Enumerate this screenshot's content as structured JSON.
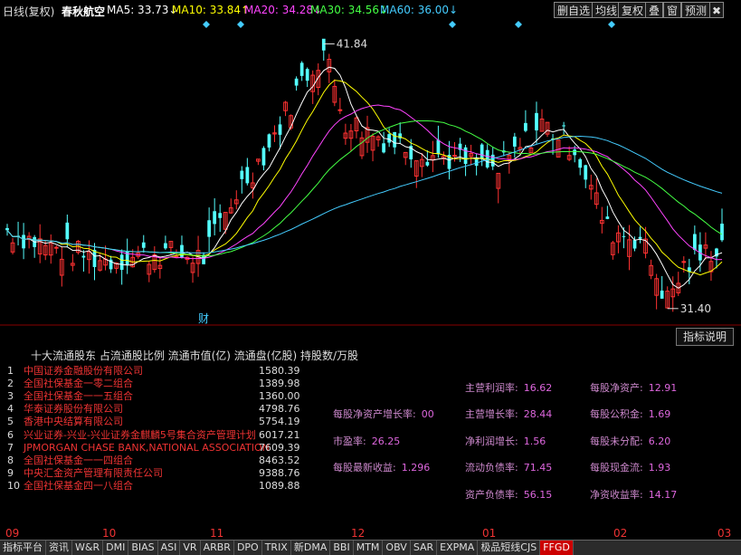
{
  "title_bar": {
    "chart_mode": "日线(复权)",
    "stock_name": "春秋航空",
    "ma5": "MA5: 33.73↓",
    "ma10": "MA10: 33.84↑",
    "ma20": "MA20: 34.28↓",
    "ma30": "MA30: 34.56↓",
    "ma60": "MA60: 36.00↓",
    "colors": {
      "ma5": "#ffffff",
      "ma10": "#ffff00",
      "ma20": "#ff44ff",
      "ma30": "#44ff44",
      "ma60": "#44ccff"
    }
  },
  "toolbar": {
    "delete_watchlist": "删自选",
    "average_line": "均线",
    "restoration": "复权",
    "overlay": "叠",
    "window": "窗",
    "forecast": "预测",
    "close": "✖"
  },
  "price_markers": {
    "high": "41.84",
    "low": "31.40",
    "finance_marker": "财"
  },
  "indicator_button": "指标说明",
  "holders": {
    "title": "十大流通股东 占流通股比例 流通市值(亿) 流通盘(亿股) 持股数/万股",
    "rows": [
      {
        "idx": "1",
        "name": "中国证券金融股份有限公司",
        "value": "1580.39"
      },
      {
        "idx": "2",
        "name": "全国社保基金一零二组合",
        "value": "1389.98"
      },
      {
        "idx": "3",
        "name": "全国社保基金一一五组合",
        "value": "1360.00"
      },
      {
        "idx": "4",
        "name": "华泰证券股份有限公司",
        "value": "4798.76"
      },
      {
        "idx": "5",
        "name": "香港中央结算有限公司",
        "value": "5754.19"
      },
      {
        "idx": "6",
        "name": "兴业证券-兴业-兴业证券金麒麟5号集合资产管理计划",
        "value": "6017.21"
      },
      {
        "idx": "7",
        "name": "JPMORGAN CHASE BANK,NATIONAL ASSOCIATION",
        "value": "7609.39"
      },
      {
        "idx": "8",
        "name": "全国社保基金一一四组合",
        "value": "8463.52"
      },
      {
        "idx": "9",
        "name": "中央汇金资产管理有限责任公司",
        "value": "9388.76"
      },
      {
        "idx": "10",
        "name": "全国社保基金四一八组合",
        "value": "1089.88"
      }
    ]
  },
  "financials": [
    {
      "label": "主营利润率:",
      "value": "16.62"
    },
    {
      "label": "每股净资产:",
      "value": "12.91"
    },
    {
      "label": "每股净资产增长率:",
      "value": "00"
    },
    {
      "label": "主营增长率:",
      "value": "28.44"
    },
    {
      "label": "每股公积金:",
      "value": "1.69"
    },
    {
      "label": "市盈率:",
      "value": "26.25"
    },
    {
      "label": "净利润增长:",
      "value": "1.56"
    },
    {
      "label": "每股未分配:",
      "value": "6.20"
    },
    {
      "label": "每股最新收益:",
      "value": "1.296"
    },
    {
      "label": "流动负债率:",
      "value": "71.45"
    },
    {
      "label": "每股现金流:",
      "value": "1.93"
    },
    {
      "label": "资产负债率:",
      "value": "56.15"
    },
    {
      "label": "净资收益率:",
      "value": "14.17"
    }
  ],
  "x_axis": {
    "labels": [
      "09",
      "10",
      "11",
      "12",
      "01",
      "02",
      "03"
    ]
  },
  "tabs": [
    "指标平台",
    "资讯",
    "W&R",
    "DMI",
    "BIAS",
    "ASI",
    "VR",
    "ARBR",
    "DPO",
    "TRIX",
    "新DMA",
    "BBI",
    "MTM",
    "OBV",
    "SAR",
    "EXPMA",
    "极品短线CJS",
    "FFGD"
  ],
  "active_tab": "FFGD",
  "chart_data": {
    "type": "candlestick",
    "x_labels": [
      "09",
      "10",
      "11",
      "12",
      "01",
      "02",
      "03"
    ],
    "high": 41.84,
    "low": 31.4,
    "ylim": [
      31.0,
      42.5
    ],
    "colors": {
      "up": "#ff3232",
      "down": "#54ffff",
      "ma5": "#ffffff",
      "ma10": "#ffff00",
      "ma20": "#ff44ff",
      "ma30": "#44ff44",
      "ma60": "#44ccff"
    }
  }
}
